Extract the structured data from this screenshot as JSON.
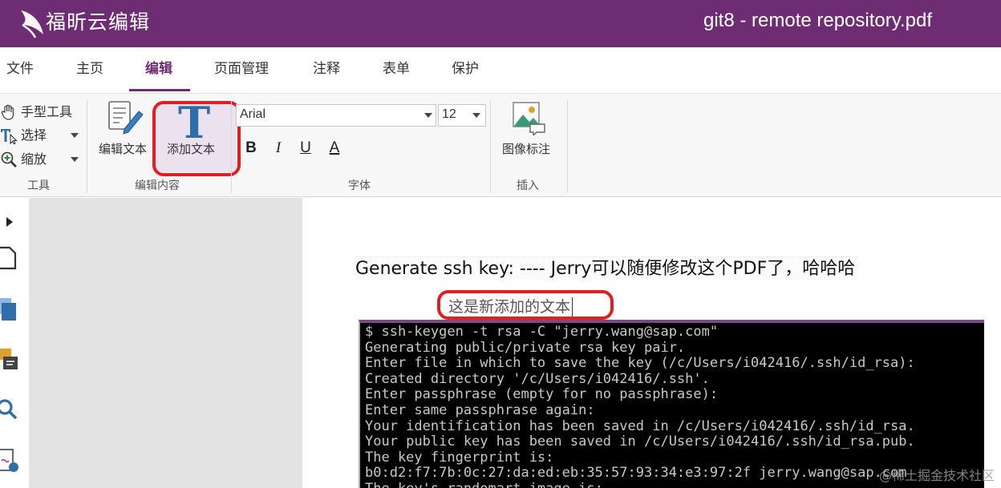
{
  "titlebar": {
    "app_name": "福昕云编辑",
    "doc_title": "git8 - remote repository.pdf"
  },
  "menu": {
    "items": [
      "文件",
      "主页",
      "编辑",
      "页面管理",
      "注释",
      "表单",
      "保护"
    ],
    "active_index": 2
  },
  "ribbon": {
    "tools": {
      "hand": "手型工具",
      "select": "选择",
      "zoom": "缩放",
      "group_label": "工具"
    },
    "edit_content": {
      "edit_text": "编辑文本",
      "add_text": "添加文本",
      "group_label": "编辑内容"
    },
    "font": {
      "family": "Arial",
      "size": "12",
      "bold": "B",
      "italic": "I",
      "underline": "U",
      "color": "A",
      "group_label": "字体"
    },
    "insert": {
      "image_annotation": "图像标注",
      "group_label": "插入"
    }
  },
  "document": {
    "heading": "Generate ssh key: ---- Jerry可以随便修改这个PDF了，哈哈哈",
    "new_text": "这是新添加的文本",
    "terminal_lines": [
      "$ ssh-keygen -t rsa -C \"jerry.wang@sap.com\"",
      "Generating public/private rsa key pair.",
      "Enter file in which to save the key (/c/Users/i042416/.ssh/id_rsa):",
      "Created directory '/c/Users/i042416/.ssh'.",
      "Enter passphrase (empty for no passphrase):",
      "Enter same passphrase again:",
      "Your identification has been saved in /c/Users/i042416/.ssh/id_rsa.",
      "Your public key has been saved in /c/Users/i042416/.ssh/id_rsa.pub.",
      "The key fingerprint is:",
      "b0:d2:f7:7b:0c:27:da:ed:eb:35:57:93:34:e3:97:2f jerry.wang@sap.com",
      "The key's randomart image is:"
    ]
  },
  "watermark": "@稀土掘金技术社区",
  "colors": {
    "brand": "#6e2d72",
    "highlight": "#e21f1f",
    "add_text_bg": "#ece1ee",
    "terminal_bg": "#000000"
  }
}
